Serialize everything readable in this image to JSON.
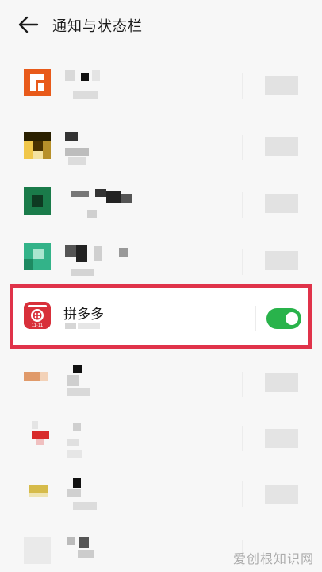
{
  "header": {
    "title": "通知与状态栏",
    "back_icon": "back-arrow-icon"
  },
  "highlighted_app": {
    "name": "拼多多",
    "notifications_enabled": true,
    "toggle_color": "#29b34b",
    "highlight_color": "#e0334a",
    "icon_color": "#d8303a",
    "icon_badge": "11·11"
  },
  "watermark": "爱创根知识网"
}
